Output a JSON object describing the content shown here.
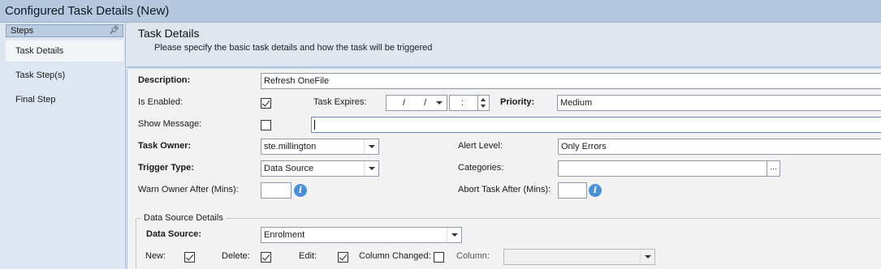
{
  "window": {
    "title": "Configured Task Details (New)"
  },
  "sidebar": {
    "header": "Steps",
    "pin_icon": "pin-icon",
    "items": [
      {
        "label": "Task Details",
        "active": true
      },
      {
        "label": "Task Step(s)",
        "active": false
      },
      {
        "label": "Final Step",
        "active": false
      }
    ]
  },
  "header": {
    "title": "Task Details",
    "subtitle": "Please specify the basic task details and how the task will be triggered"
  },
  "form": {
    "description": {
      "label": "Description:",
      "value": "Refresh OneFile"
    },
    "is_enabled": {
      "label": "Is Enabled:",
      "checked": true
    },
    "task_expires": {
      "label": "Task Expires:",
      "date": "/ /",
      "time": ":"
    },
    "priority": {
      "label": "Priority:",
      "value": "Medium"
    },
    "show_message": {
      "label": "Show Message:",
      "checked": false,
      "value": ""
    },
    "task_owner": {
      "label": "Task Owner:",
      "value": "ste.millington"
    },
    "alert_level": {
      "label": "Alert Level:",
      "value": "Only Errors"
    },
    "trigger_type": {
      "label": "Trigger Type:",
      "value": "Data Source"
    },
    "categories": {
      "label": "Categories:",
      "value": "",
      "button": "..."
    },
    "warn_owner": {
      "label": "Warn Owner After (Mins):",
      "value": ""
    },
    "abort_task": {
      "label": "Abort Task After (Mins):",
      "value": ""
    },
    "info_glyph": "i"
  },
  "data_source_group": {
    "title": "Data Source Details",
    "data_source": {
      "label": "Data Source:",
      "value": "Enrolment"
    },
    "new": {
      "label": "New:",
      "checked": true
    },
    "delete": {
      "label": "Delete:",
      "checked": true
    },
    "edit": {
      "label": "Edit:",
      "checked": true
    },
    "column_changed": {
      "label": "Column Changed:",
      "checked": false
    },
    "column": {
      "label": "Column:",
      "value": ""
    }
  },
  "colors": {
    "titlebar": "#b4c9e0",
    "sidebar": "#dde6f1",
    "info": "#4a90d9"
  }
}
